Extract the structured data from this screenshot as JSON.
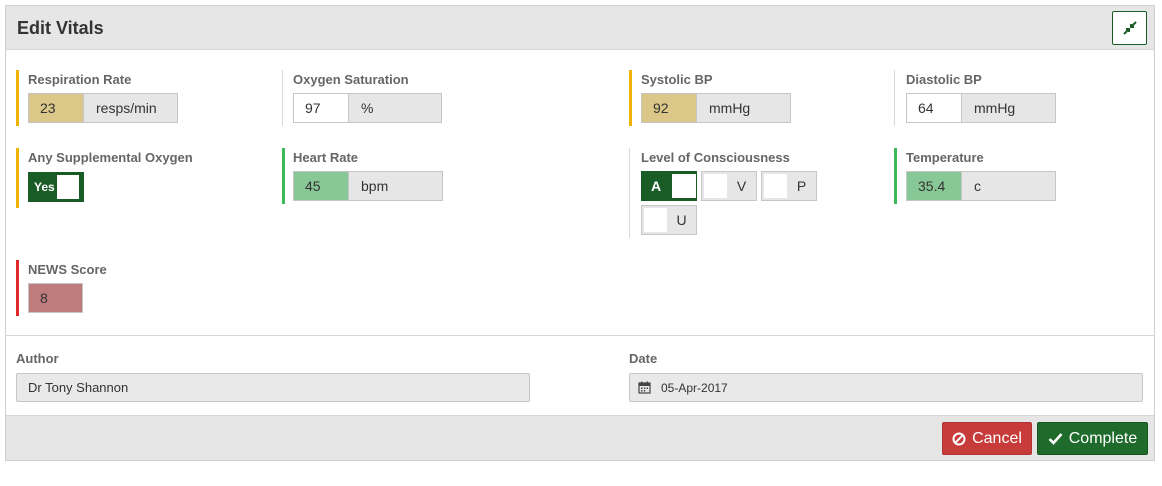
{
  "header": {
    "title": "Edit Vitals",
    "collapse_icon": "compress-arrows-icon"
  },
  "colors": {
    "amber": "#dbc788",
    "green": "#88c796",
    "red": "#bf7c7d",
    "dark_green": "#1a5c25",
    "amber_bar": "#f0b400",
    "green_bar": "#3cb957",
    "red_bar": "#e02929"
  },
  "vitals": {
    "respiration_rate": {
      "label": "Respiration Rate",
      "value": "23",
      "unit": "resps/min"
    },
    "oxygen_saturation": {
      "label": "Oxygen Saturation",
      "value": "97",
      "unit": "%"
    },
    "systolic_bp": {
      "label": "Systolic BP",
      "value": "92",
      "unit": "mmHg"
    },
    "diastolic_bp": {
      "label": "Diastolic BP",
      "value": "64",
      "unit": "mmHg"
    },
    "supplemental_oxygen": {
      "label": "Any Supplemental Oxygen",
      "toggle_label": "Yes",
      "on": true
    },
    "heart_rate": {
      "label": "Heart Rate",
      "value": "45",
      "unit": "bpm"
    },
    "consciousness": {
      "label": "Level of Consciousness",
      "options": [
        "A",
        "V",
        "P",
        "U"
      ],
      "selected": "A"
    },
    "temperature": {
      "label": "Temperature",
      "value": "35.4",
      "unit": "c"
    },
    "news_score": {
      "label": "NEWS Score",
      "value": "8"
    }
  },
  "author": {
    "label": "Author",
    "value": "Dr Tony Shannon"
  },
  "date": {
    "label": "Date",
    "value": "05-Apr-2017",
    "icon": "calendar-icon"
  },
  "actions": {
    "cancel_label": "Cancel",
    "complete_label": "Complete"
  }
}
